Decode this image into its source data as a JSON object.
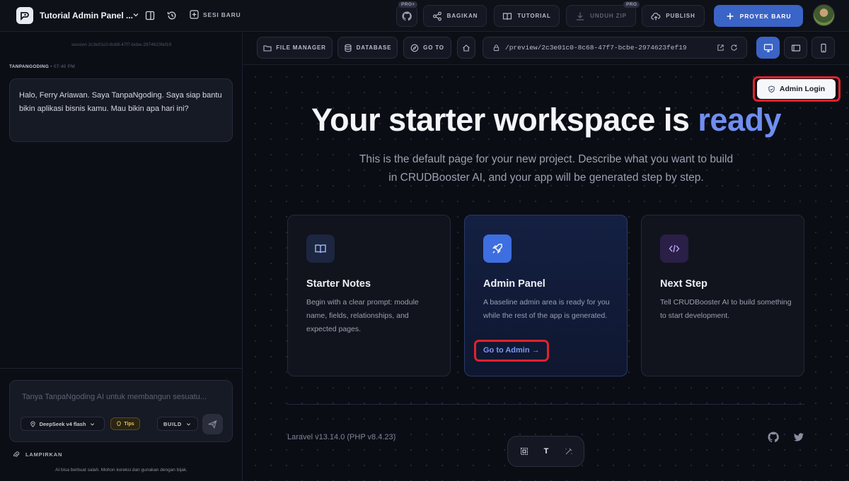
{
  "header": {
    "project_title": "Tutorial Admin Panel ...",
    "new_session_label": "SESI BARU",
    "pro_plus_badge": "PRO+",
    "share_label": "BAGIKAN",
    "tutorial_label": "TUTORIAL",
    "download_zip_label": "UNDUH ZIP",
    "pro_badge": "PRO",
    "publish_label": "PUBLISH",
    "new_project_label": "PROYEK BARU"
  },
  "chat": {
    "session_id": "session 2c3e01c0-8c68-47f7-bcbe-2974623fef19",
    "sender": "TANPANGODING",
    "time": "• 07:40 PM",
    "message": "Halo, Ferry Ariawan. Saya TanpaNgoding. Saya siap bantu bikin aplikasi bisnis kamu. Mau bikin apa hari ini?",
    "input_placeholder": "Tanya TanpaNgoding AI untuk membangun sesuatu...",
    "model": "DeepSeek v4 flash",
    "tips_label": "Tips",
    "mode": "BUILD",
    "attach_label": "LAMPIRKAN",
    "disclaimer": "AI bisa berbuat salah. Mohon koreksi dan gunakan dengan bijak."
  },
  "preview_toolbar": {
    "file_manager_label": "FILE MANAGER",
    "database_label": "DATABASE",
    "goto_label": "GO TO",
    "url": "/preview/2c3e01c0-8c68-47f7-bcbe-2974623fef19"
  },
  "preview": {
    "admin_login_label": "Admin Login",
    "hero_text": "Your starter workspace is ",
    "hero_accent": "ready",
    "subtitle": "This is the default page for your new project. Describe what you want to build in CRUDBooster AI, and your app will be generated step by step.",
    "cards": [
      {
        "title": "Starter Notes",
        "description": "Begin with a clear prompt: module name, fields, relationships, and expected pages."
      },
      {
        "title": "Admin Panel",
        "description": "A baseline admin area is ready for you while the rest of the app is generated.",
        "link": "Go to Admin →"
      },
      {
        "title": "Next Step",
        "description": "Tell CRUDBooster AI to build something to start development."
      }
    ],
    "version": "Laravel v13.14.0 (PHP v8.4.23)",
    "floatbar_text_tool": "T"
  },
  "colors": {
    "accent_blue": "#3b64c7",
    "hero_accent": "#6f8ff0",
    "highlight_red": "#e0232b"
  }
}
